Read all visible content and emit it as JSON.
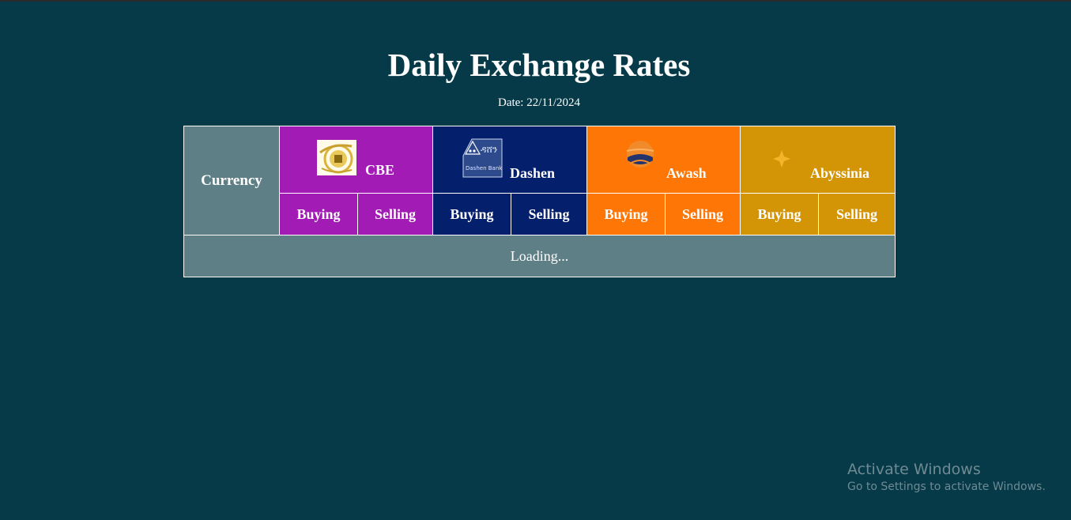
{
  "page": {
    "title": "Daily Exchange Rates",
    "date_text": "Date: 22/11/2024"
  },
  "table": {
    "currency_header": "Currency",
    "banks": [
      {
        "name": "CBE",
        "color": "#a11bb4",
        "buying": "Buying",
        "selling": "Selling",
        "logo": "cbe-logo"
      },
      {
        "name": "Dashen",
        "color": "#041f6b",
        "buying": "Buying",
        "selling": "Selling",
        "logo": "dashen-logo"
      },
      {
        "name": "Awash",
        "color": "#fe7605",
        "buying": "Buying",
        "selling": "Selling",
        "logo": "awash-logo"
      },
      {
        "name": "Abyssinia",
        "color": "#d39406",
        "buying": "Buying",
        "selling": "Selling",
        "logo": "abyssinia-logo"
      }
    ],
    "loading_text": "Loading...",
    "dashen_logo_text": "ዳሸን",
    "dashen_logo_caption": "Dashen Bank"
  },
  "watermark": {
    "line1": "Activate Windows",
    "line2": "Go to Settings to activate Windows."
  },
  "colors": {
    "background": "#063a48",
    "currency_cell": "#5f7f87"
  }
}
